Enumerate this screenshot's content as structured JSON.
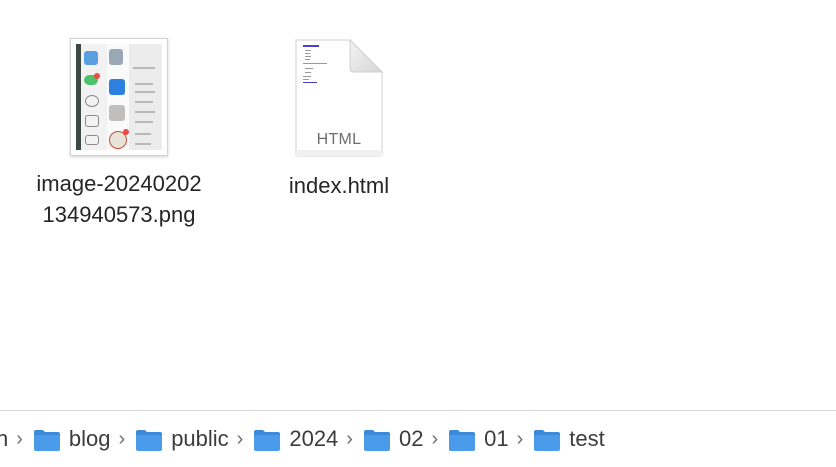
{
  "files": [
    {
      "name": "image-20240202134940573.png",
      "name_line1": "image-20240202",
      "name_line2": "134940573.png",
      "kind": "png-thumbnail"
    },
    {
      "name": "index.html",
      "kind": "html-document",
      "icon_label": "HTML"
    }
  ],
  "path_bar": {
    "leading_fragment": "n",
    "crumbs": [
      {
        "label": "blog",
        "icon": "folder-icon"
      },
      {
        "label": "public",
        "icon": "folder-icon"
      },
      {
        "label": "2024",
        "icon": "folder-icon"
      },
      {
        "label": "02",
        "icon": "folder-icon"
      },
      {
        "label": "01",
        "icon": "folder-icon"
      },
      {
        "label": "test",
        "icon": "folder-icon"
      }
    ],
    "separator": "›"
  },
  "colors": {
    "folder": "#4a9cea",
    "folder_dark": "#3d8ad8",
    "text": "#262626"
  }
}
